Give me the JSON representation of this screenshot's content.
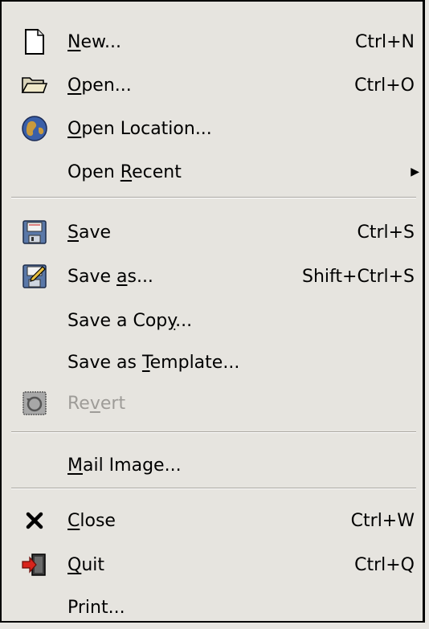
{
  "menu": {
    "items": [
      {
        "pre": "",
        "mnemonic": "N",
        "post": "ew...",
        "accel": "Ctrl+N",
        "icon": "new-document-icon"
      },
      {
        "pre": "",
        "mnemonic": "O",
        "post": "pen...",
        "accel": "Ctrl+O",
        "icon": "open-folder-icon"
      },
      {
        "pre": "",
        "mnemonic": "O",
        "post": "pen Location...",
        "accel": "",
        "icon": "globe-icon"
      },
      {
        "pre": "Open ",
        "mnemonic": "R",
        "post": "ecent",
        "accel": "",
        "icon": "submenu-arrow-icon"
      },
      {
        "pre": "",
        "mnemonic": "S",
        "post": "ave",
        "accel": "Ctrl+S",
        "icon": "save-disk-icon"
      },
      {
        "pre": "Save ",
        "mnemonic": "a",
        "post": "s...",
        "accel": "Shift+Ctrl+S",
        "icon": "save-as-disk-icon"
      },
      {
        "pre": "Save a Cop",
        "mnemonic": "y",
        "post": "...",
        "accel": "",
        "icon": ""
      },
      {
        "pre": "Save as ",
        "mnemonic": "T",
        "post": "emplate...",
        "accel": "",
        "icon": ""
      },
      {
        "pre": "Re",
        "mnemonic": "v",
        "post": "ert",
        "accel": "",
        "icon": "revert-icon"
      },
      {
        "pre": "",
        "mnemonic": "M",
        "post": "ail Image...",
        "accel": "",
        "icon": ""
      },
      {
        "pre": "",
        "mnemonic": "C",
        "post": "lose",
        "accel": "Ctrl+W",
        "icon": "close-x-icon"
      },
      {
        "pre": "",
        "mnemonic": "Q",
        "post": "uit",
        "accel": "Ctrl+Q",
        "icon": "quit-exit-icon"
      },
      {
        "pre": "Print...",
        "mnemonic": "",
        "post": "",
        "accel": "",
        "icon": ""
      }
    ]
  },
  "colors": {
    "background": "#e6e4df",
    "disabled_text": "#9e9c98"
  }
}
